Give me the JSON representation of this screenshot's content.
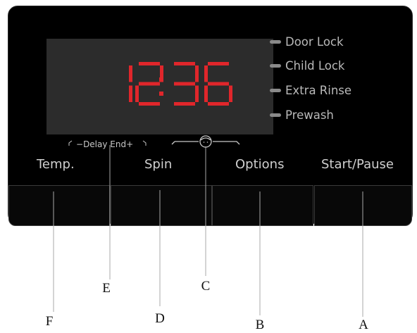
{
  "clock": {
    "hours": "12",
    "minutes": "36",
    "segment_color": "#e0262b"
  },
  "indicators": [
    {
      "label": "Door Lock"
    },
    {
      "label": "Child Lock"
    },
    {
      "label": "Extra Rinse"
    },
    {
      "label": "Prewash"
    }
  ],
  "delay_end": {
    "minus": "−",
    "label": "Delay End",
    "plus": "+"
  },
  "buttons": [
    {
      "label": "Temp."
    },
    {
      "label": "Spin"
    },
    {
      "label": "Options"
    },
    {
      "label": "Start/Pause"
    }
  ],
  "child_lock_icon": "child-face-icon",
  "callouts": {
    "A": "A",
    "B": "B",
    "C": "C",
    "D": "D",
    "E": "E",
    "F": "F"
  }
}
